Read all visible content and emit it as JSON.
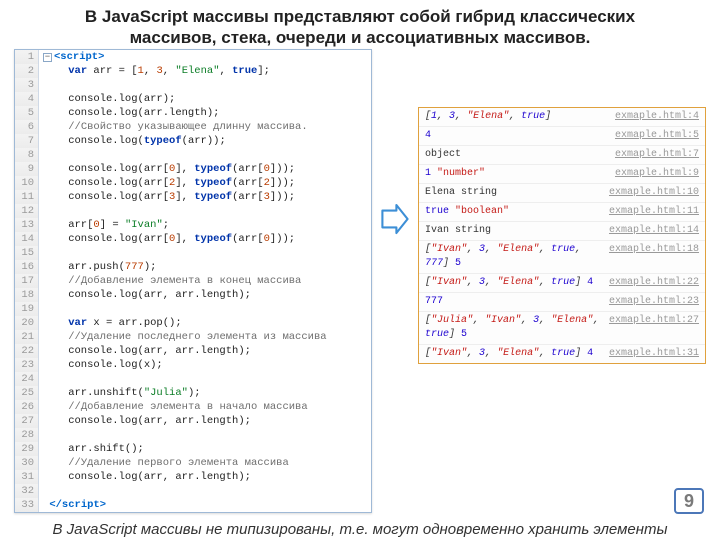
{
  "title": "В JavaScript массивы представляют собой гибрид классических массивов, стека, очереди и ассоциативных массивов.",
  "footer": "В JavaScript массивы не типизированы, т.е. могут одновременно хранить элементы",
  "page_number": "9",
  "code": {
    "lines": [
      {
        "n": 1,
        "html": "<span class='minus'>−</span><span class='tag'>&lt;script&gt;</span>"
      },
      {
        "n": 2,
        "html": "    <span class='kw'>var</span> arr = [<span class='num'>1</span>, <span class='num'>3</span>, <span class='str'>\"Elena\"</span>, <span class='kw'>true</span>];"
      },
      {
        "n": 3,
        "html": ""
      },
      {
        "n": 4,
        "html": "    console.log(arr);"
      },
      {
        "n": 5,
        "html": "    console.log(arr.length);"
      },
      {
        "n": 6,
        "html": "    <span class='cmt'>//Свойство указывающее длинну массива.</span>"
      },
      {
        "n": 7,
        "html": "    console.log(<span class='kw'>typeof</span>(arr));"
      },
      {
        "n": 8,
        "html": ""
      },
      {
        "n": 9,
        "html": "    console.log(arr[<span class='num'>0</span>], <span class='kw'>typeof</span>(arr[<span class='num'>0</span>]));"
      },
      {
        "n": 10,
        "html": "    console.log(arr[<span class='num'>2</span>], <span class='kw'>typeof</span>(arr[<span class='num'>2</span>]));"
      },
      {
        "n": 11,
        "html": "    console.log(arr[<span class='num'>3</span>], <span class='kw'>typeof</span>(arr[<span class='num'>3</span>]));"
      },
      {
        "n": 12,
        "html": ""
      },
      {
        "n": 13,
        "html": "    arr[<span class='num'>0</span>] = <span class='str'>\"Ivan\"</span>;"
      },
      {
        "n": 14,
        "html": "    console.log(arr[<span class='num'>0</span>], <span class='kw'>typeof</span>(arr[<span class='num'>0</span>]));"
      },
      {
        "n": 15,
        "html": ""
      },
      {
        "n": 16,
        "html": "    arr.push(<span class='num'>777</span>);"
      },
      {
        "n": 17,
        "html": "    <span class='cmt'>//Добавление элемента в конец массива</span>"
      },
      {
        "n": 18,
        "html": "    console.log(arr, arr.length);"
      },
      {
        "n": 19,
        "html": ""
      },
      {
        "n": 20,
        "html": "    <span class='kw'>var</span> x = arr.pop();"
      },
      {
        "n": 21,
        "html": "    <span class='cmt'>//Удаление последнего элемента из массива</span>"
      },
      {
        "n": 22,
        "html": "    console.log(arr, arr.length);"
      },
      {
        "n": 23,
        "html": "    console.log(x);"
      },
      {
        "n": 24,
        "html": ""
      },
      {
        "n": 25,
        "html": "    arr.unshift(<span class='str'>\"Julia\"</span>);"
      },
      {
        "n": 26,
        "html": "    <span class='cmt'>//Добавление элемента в начало массива</span>"
      },
      {
        "n": 27,
        "html": "    console.log(arr, arr.length);"
      },
      {
        "n": 28,
        "html": ""
      },
      {
        "n": 29,
        "html": "    arr.shift();"
      },
      {
        "n": 30,
        "html": "    <span class='cmt'>//Удаление первого элемента массива</span>"
      },
      {
        "n": 31,
        "html": "    console.log(arr, arr.length);"
      },
      {
        "n": 32,
        "html": ""
      },
      {
        "n": 33,
        "html": " <span class='tag'>&lt;/script&gt;</span>"
      }
    ]
  },
  "console": {
    "rows": [
      {
        "out": "<span class='ital'>[<span class='num'>1</span>, <span class='num'>3</span>, <span class='str'>\"Elena\"</span>, <span class='bool'>true</span>]</span>",
        "src": "exmaple.html:4"
      },
      {
        "out": "<span class='num'>4</span>",
        "src": "exmaple.html:5"
      },
      {
        "out": "object",
        "src": "exmaple.html:7"
      },
      {
        "out": "<span class='num'>1</span> <span class='str'>\"number\"</span>",
        "src": "exmaple.html:9"
      },
      {
        "out": "Elena string",
        "src": "exmaple.html:10"
      },
      {
        "out": "<span class='bool'>true</span> <span class='str'>\"boolean\"</span>",
        "src": "exmaple.html:11"
      },
      {
        "out": "Ivan string",
        "src": "exmaple.html:14"
      },
      {
        "out": "<span class='ital'>[<span class='str'>\"Ivan\"</span>, <span class='num'>3</span>, <span class='str'>\"Elena\"</span>, <span class='bool'>true</span>, <span class='num'>777</span>]</span> <span class='num'>5</span>",
        "src": "exmaple.html:18"
      },
      {
        "out": "<span class='ital'>[<span class='str'>\"Ivan\"</span>, <span class='num'>3</span>, <span class='str'>\"Elena\"</span>, <span class='bool'>true</span>]</span> <span class='num'>4</span>",
        "src": "exmaple.html:22"
      },
      {
        "out": "<span class='num'>777</span>",
        "src": "exmaple.html:23"
      },
      {
        "out": "<span class='ital'>[<span class='str'>\"Julia\"</span>, <span class='str'>\"Ivan\"</span>, <span class='num'>3</span>, <span class='str'>\"Elena\"</span>, <span class='bool'>true</span>]</span> <span class='num'>5</span>",
        "src": "exmaple.html:27"
      },
      {
        "out": "<span class='ital'>[<span class='str'>\"Ivan\"</span>, <span class='num'>3</span>, <span class='str'>\"Elena\"</span>, <span class='bool'>true</span>]</span> <span class='num'>4</span>",
        "src": "exmaple.html:31"
      }
    ]
  }
}
